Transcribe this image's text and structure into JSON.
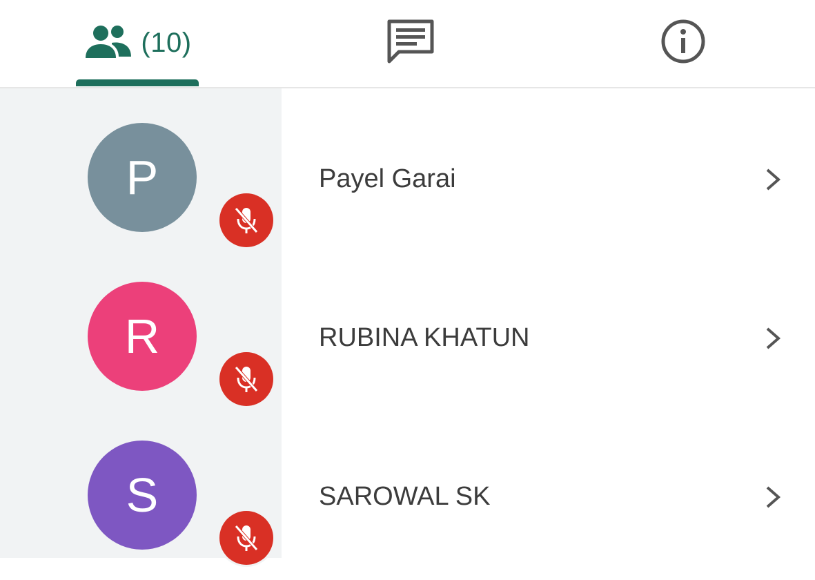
{
  "tabs": {
    "people": {
      "icon": "people-icon",
      "count_label": "(10)"
    },
    "chat": {
      "icon": "chat-icon"
    },
    "info": {
      "icon": "info-icon"
    }
  },
  "participants": [
    {
      "initial": "P",
      "name": "Payel Garai",
      "avatar_color": "#78909c",
      "muted": true
    },
    {
      "initial": "R",
      "name": "RUBINA KHATUN",
      "avatar_color": "#ec407a",
      "muted": true
    },
    {
      "initial": "S",
      "name": "SAROWAL SK",
      "avatar_color": "#7e57c2",
      "muted": true
    }
  ],
  "colors": {
    "accent": "#1e6f5c",
    "muted_badge": "#d93025"
  }
}
